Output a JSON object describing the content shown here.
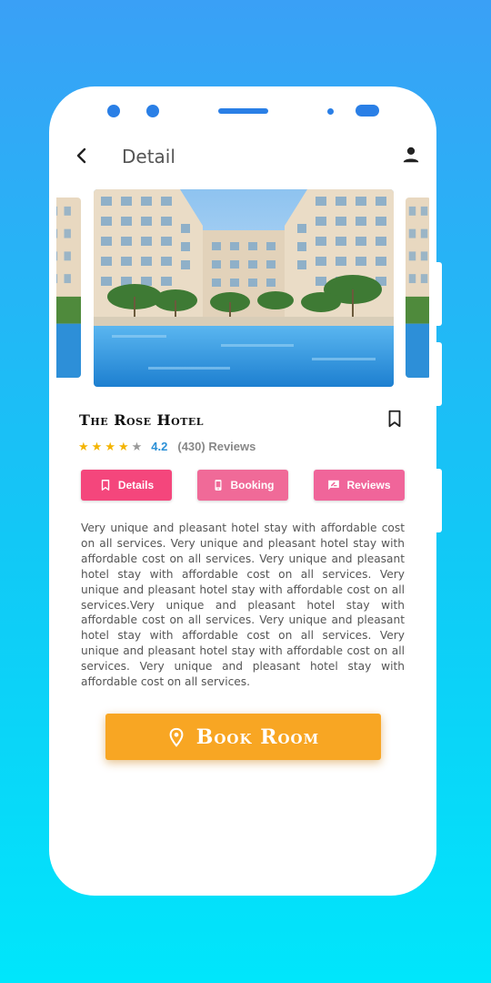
{
  "appbar": {
    "title": "Detail",
    "back_icon": "chevron-left-icon",
    "profile_icon": "person-icon"
  },
  "hotel": {
    "name": "The Rose Hotel",
    "rating": "4.2",
    "rating_stars": 4,
    "reviews": "(430) Reviews",
    "bookmark_icon": "bookmark-outline-icon"
  },
  "tabs": [
    {
      "label": "Details",
      "icon": "bookmark-icon",
      "color": "#f4467c"
    },
    {
      "label": "Booking",
      "icon": "phone-icon",
      "color": "#f06a98"
    },
    {
      "label": "Reviews",
      "icon": "rate-review-icon",
      "color": "#f0659a"
    }
  ],
  "description": " Very unique and pleasant hotel stay with affordable cost on all services. Very unique and pleasant hotel stay with affordable cost on all services. Very unique and pleasant hotel stay with affordable cost on all services. Very unique and pleasant hotel stay with affordable cost on all services.Very unique and pleasant hotel stay with affordable cost on all services. Very unique and pleasant hotel stay with affordable cost on all services. Very unique and pleasant hotel stay with affordable cost on all services. Very unique and pleasant hotel stay with affordable cost on all services.",
  "book_button": {
    "label": "Book Room",
    "icon": "location-pin-icon",
    "color": "#f8a623"
  },
  "colors": {
    "background_top": "#3aa0f6",
    "background_bottom": "#00e6fb",
    "accent_blue": "#2a8fd6",
    "star": "#f4b400"
  }
}
